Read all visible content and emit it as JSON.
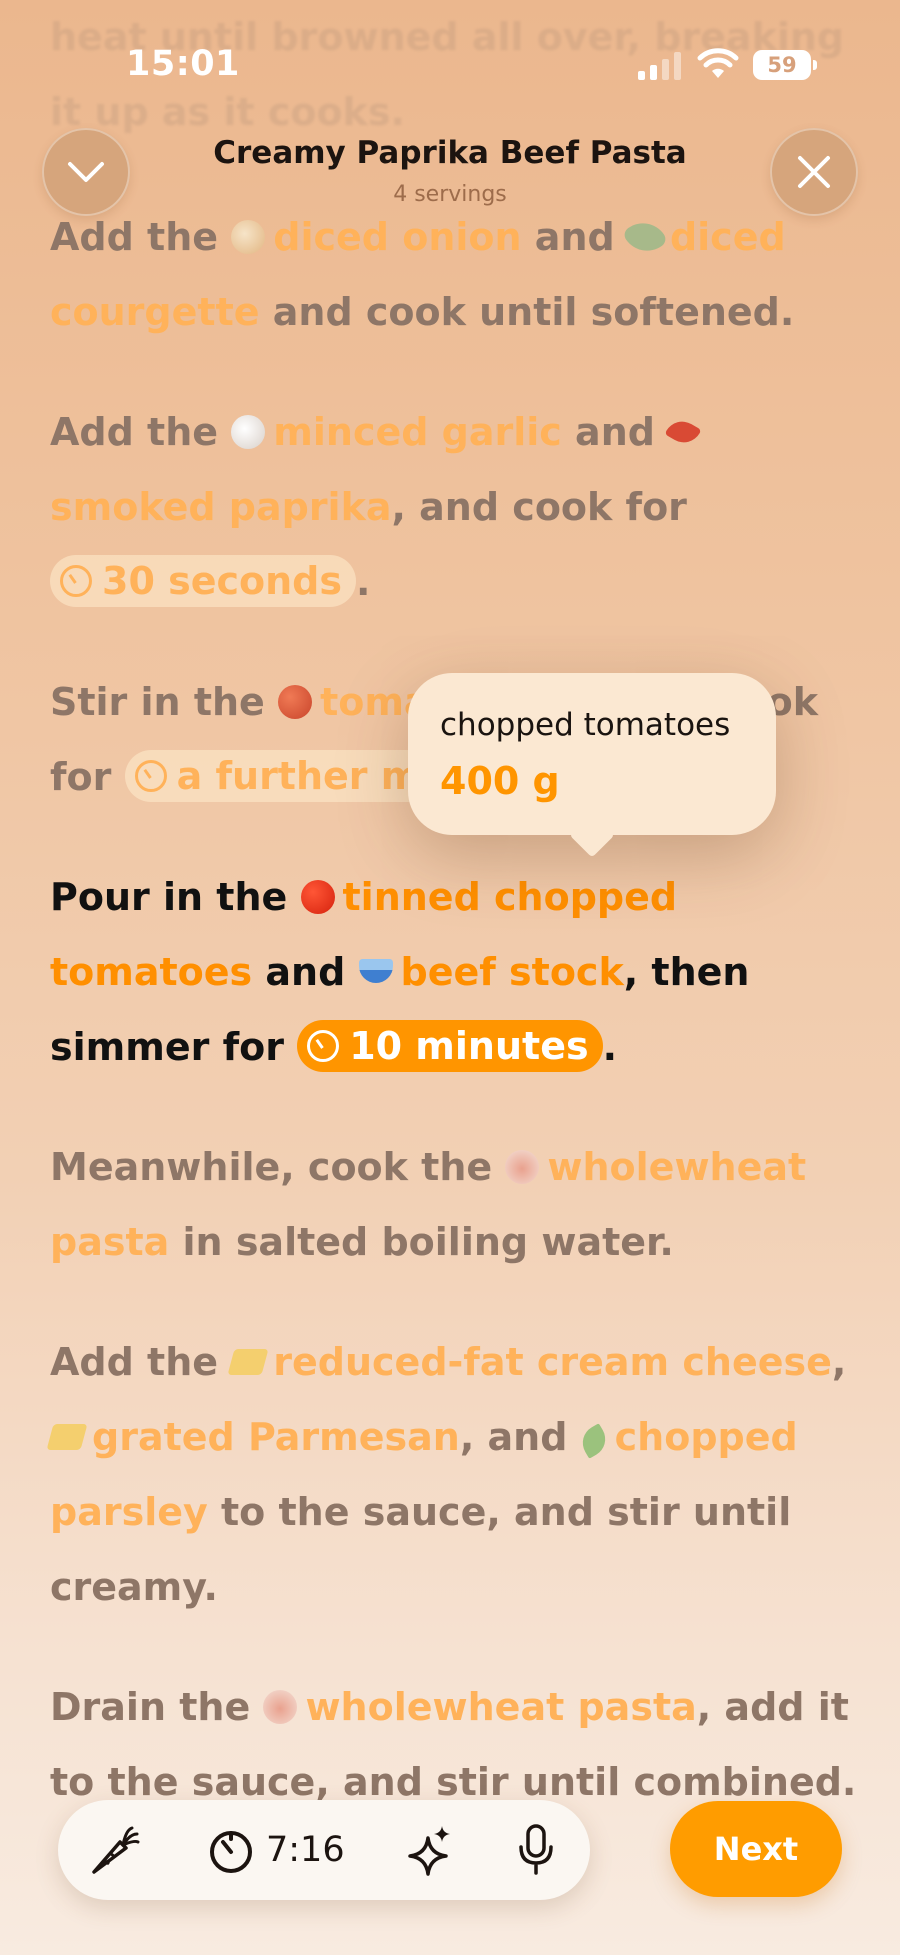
{
  "status": {
    "time": "15:01",
    "battery": "59"
  },
  "header": {
    "title": "Creamy Paprika Beef Pasta",
    "servings": "4 servings"
  },
  "ghost_text": "heat until browned all over, breaking it up as it cooks.",
  "steps": [
    {
      "parts": [
        {
          "t": "text",
          "v": "Add the "
        },
        {
          "t": "ing",
          "icon": "onion-icon",
          "v": "diced onion"
        },
        {
          "t": "text",
          "v": " and "
        },
        {
          "t": "ing",
          "icon": "courgette-icon",
          "v": "diced courgette"
        },
        {
          "t": "text",
          "v": " and cook until softened."
        }
      ]
    },
    {
      "parts": [
        {
          "t": "text",
          "v": "Add the "
        },
        {
          "t": "ing",
          "icon": "garlic-icon",
          "v": "minced garlic"
        },
        {
          "t": "text",
          "v": " and "
        },
        {
          "t": "ing",
          "icon": "chili-icon",
          "v": "smoked paprika"
        },
        {
          "t": "text",
          "v": ", and cook for "
        },
        {
          "t": "timer",
          "v": "30 seconds"
        },
        {
          "t": "text",
          "v": "."
        }
      ]
    },
    {
      "parts": [
        {
          "t": "text",
          "v": "Stir in the "
        },
        {
          "t": "ing",
          "icon": "tomato-icon",
          "v": "tomato puree"
        },
        {
          "t": "text",
          "v": " and cook for "
        },
        {
          "t": "timer",
          "v": "a further minute"
        },
        {
          "t": "text",
          "v": "."
        }
      ]
    },
    {
      "active": true,
      "parts": [
        {
          "t": "text",
          "v": "Pour in the "
        },
        {
          "t": "ing",
          "icon": "tomato-icon",
          "v": "tinned chopped tomatoes"
        },
        {
          "t": "text",
          "v": " and "
        },
        {
          "t": "ing",
          "icon": "bowl-icon",
          "v": "beef stock"
        },
        {
          "t": "text",
          "v": ", then simmer for "
        },
        {
          "t": "timer",
          "v": "10 minutes"
        },
        {
          "t": "text",
          "v": "."
        }
      ]
    },
    {
      "parts": [
        {
          "t": "text",
          "v": "Meanwhile, cook the "
        },
        {
          "t": "ing",
          "icon": "pasta-icon",
          "v": "wholewheat pasta"
        },
        {
          "t": "text",
          "v": " in salted boiling water."
        }
      ]
    },
    {
      "parts": [
        {
          "t": "text",
          "v": "Add the "
        },
        {
          "t": "ing",
          "icon": "cheese-icon",
          "v": "reduced-fat cream cheese"
        },
        {
          "t": "text",
          "v": ", "
        },
        {
          "t": "ing",
          "icon": "cheese-icon",
          "v": "grated Parmesan"
        },
        {
          "t": "text",
          "v": ", and "
        },
        {
          "t": "ing",
          "icon": "herb-icon",
          "v": "chopped parsley"
        },
        {
          "t": "text",
          "v": " to the sauce, and stir until creamy."
        }
      ]
    },
    {
      "parts": [
        {
          "t": "text",
          "v": "Drain the "
        },
        {
          "t": "ing",
          "icon": "pasta-icon",
          "v": "wholewheat pasta"
        },
        {
          "t": "text",
          "v": ", add it to the sauce, and stir until combined."
        }
      ]
    }
  ],
  "tooltip": {
    "name": "chopped tomatoes",
    "quantity": "400 g"
  },
  "toolbar": {
    "timer": "7:16",
    "next_label": "Next"
  }
}
